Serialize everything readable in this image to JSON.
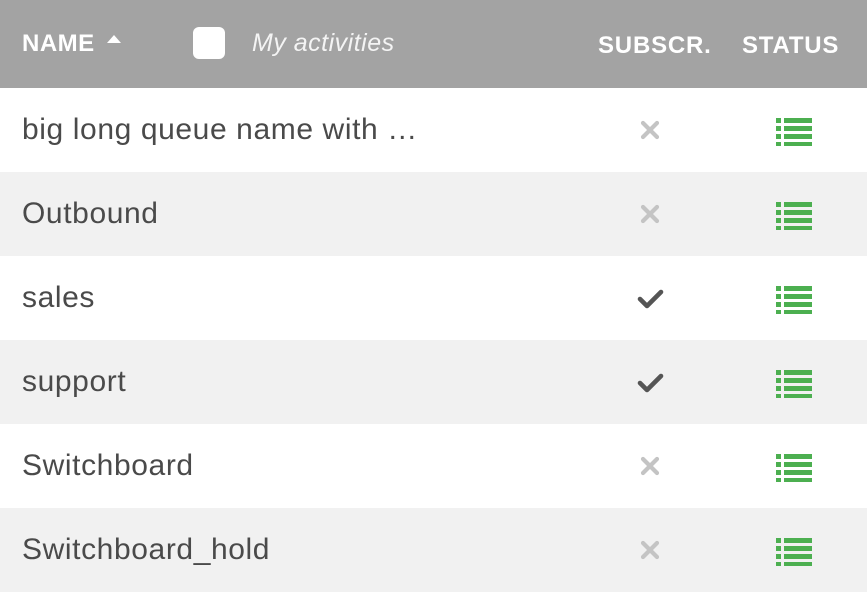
{
  "header": {
    "name_label": "NAME",
    "sort_icon": "caret-up-icon",
    "my_activities_label": "My activities",
    "my_activities_checked": false,
    "subscr_label": "SUBSCR.",
    "status_label": "STATUS"
  },
  "colors": {
    "header_bg": "#a3a3a3",
    "row_alt_bg": "#f1f1f1",
    "status_icon": "#4caf50",
    "check_icon": "#555555",
    "cross_icon": "#c4c4c4"
  },
  "rows": [
    {
      "name": "big long queue name with …",
      "subscribed": false,
      "subscr_icon": "cross-icon",
      "status_icon": "list-icon"
    },
    {
      "name": "Outbound",
      "subscribed": false,
      "subscr_icon": "cross-icon",
      "status_icon": "list-icon"
    },
    {
      "name": "sales",
      "subscribed": true,
      "subscr_icon": "check-icon",
      "status_icon": "list-icon"
    },
    {
      "name": "support",
      "subscribed": true,
      "subscr_icon": "check-icon",
      "status_icon": "list-icon"
    },
    {
      "name": "Switchboard",
      "subscribed": false,
      "subscr_icon": "cross-icon",
      "status_icon": "list-icon"
    },
    {
      "name": "Switchboard_hold",
      "subscribed": false,
      "subscr_icon": "cross-icon",
      "status_icon": "list-icon"
    }
  ]
}
